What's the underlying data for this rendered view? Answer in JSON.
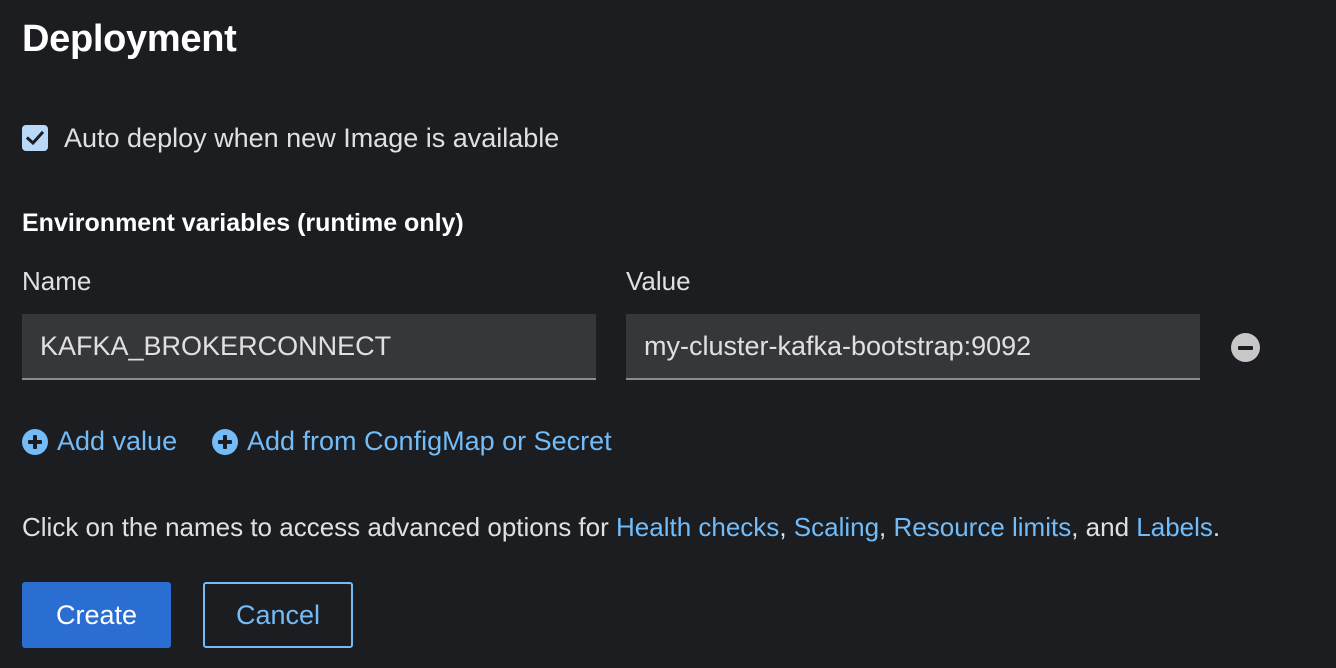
{
  "form": {
    "title": "Deployment",
    "auto_deploy": {
      "checked": true,
      "label": "Auto deploy when new Image is available"
    },
    "env": {
      "section_title": "Environment variables (runtime only)",
      "name_header": "Name",
      "value_header": "Value",
      "rows": [
        {
          "name": "KAFKA_BROKERCONNECT",
          "value": "my-cluster-kafka-bootstrap:9092"
        }
      ],
      "add_value_label": "Add value",
      "add_from_label": "Add from ConfigMap or Secret"
    },
    "help": {
      "prefix": "Click on the names to access advanced options for ",
      "health_checks": "Health checks",
      "sep1": ", ",
      "scaling": "Scaling",
      "sep2": ", ",
      "resource_limits": "Resource limits",
      "sep3": ", and ",
      "labels": "Labels",
      "suffix": "."
    },
    "buttons": {
      "create": "Create",
      "cancel": "Cancel"
    }
  },
  "colors": {
    "background": "#1b1d21",
    "link": "#73bcf7",
    "primary": "#2b6ed2",
    "checkbox": "#b9d9f9",
    "field_bg": "#36373a"
  },
  "icons": {
    "checkbox": "checkmark-icon",
    "remove": "minus-circle-icon",
    "add": "plus-circle-icon"
  }
}
